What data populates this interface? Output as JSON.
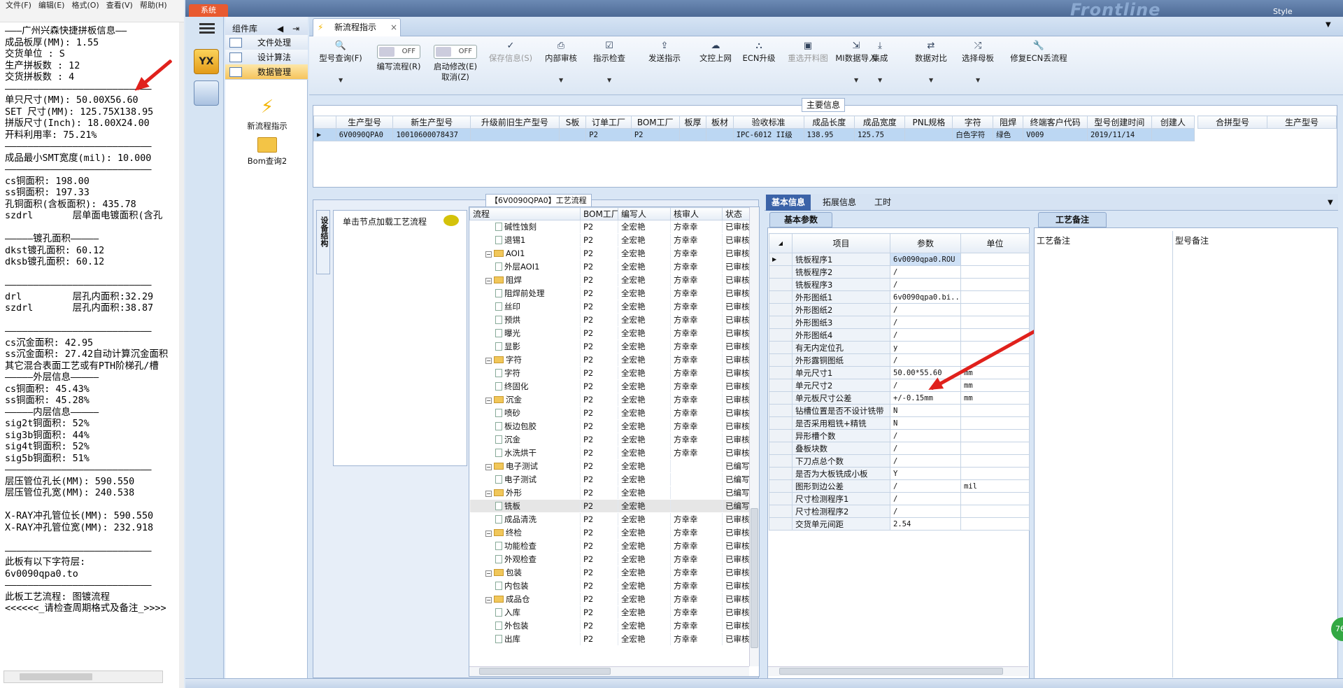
{
  "notepad": {
    "menu": [
      "文件(F)",
      "编辑(E)",
      "格式(O)",
      "查看(V)",
      "帮助(H)"
    ],
    "lines": [
      "———广州兴森快捷拼板信息——",
      "成品板厚(MM): 1.55",
      "交货单位 : S",
      "生产拼板数 : 12",
      "交货拼板数 : 4",
      "——————————————————————————",
      "单只尺寸(MM): 50.00X56.60",
      "SET 尺寸(MM): 125.75X138.95",
      "拼版尺寸(Inch): 18.00X24.00",
      "开料利用率: 75.21%",
      "——————————————————————————",
      "成品最小SMT宽度(mil): 10.000",
      "——————————————————————————",
      "cs铜面积: 198.00",
      "ss铜面积: 197.33",
      "孔铜面积(含板面积): 435.78",
      "szdrl       层单面电镀面积(含孔",
      "",
      "—————镀孔面积—————",
      "dkst镀孔面积: 60.12",
      "dksb镀孔面积: 60.12",
      "",
      "——————————————————————————",
      "drl         层孔内面积:32.29",
      "szdrl       层孔内面积:38.87",
      "",
      "——————————————————————————",
      "cs沉金面积: 42.95",
      "ss沉金面积: 27.42自动计算沉金面积",
      "其它混合表面工艺或有PTH阶梯孔/槽",
      "—————外层信息—————",
      "cs铜面积: 45.43%",
      "ss铜面积: 45.28%",
      "—————内层信息—————",
      "sig2t铜面积: 52%",
      "sig3b铜面积: 44%",
      "sig4t铜面积: 52%",
      "sig5b铜面积: 51%",
      "——————————————————————————",
      "层压管位孔长(MM): 590.550",
      "层压管位孔宽(MM): 240.538",
      "",
      "X-RAY冲孔管位长(MM): 590.550",
      "X-RAY冲孔管位宽(MM): 232.918",
      "",
      "——————————————————————————",
      "此板有以下字符层:",
      "6v0090qpa0.to",
      "——————————————————————————",
      "此板工艺流程: 图镀流程",
      "<<<<<<_请检查周期格式及备注_>>>>"
    ]
  },
  "app": {
    "sys_tab": "系统",
    "brand": "Frontline",
    "style_label": "Style",
    "component_lib": "组件库",
    "comp_items": [
      "文件处理",
      "设计算法",
      "数据管理"
    ],
    "tools": [
      "新流程指示",
      "Bom查询2"
    ],
    "doc_tab": "新流程指示",
    "ribbon": [
      {
        "label": "型号查询(F)",
        "icon": "search-icon",
        "dd": true,
        "dis": false
      },
      {
        "label": "编写流程(R)",
        "icon": "toggle-off",
        "dd": false,
        "dis": false,
        "toggle": "OFF"
      },
      {
        "label": "启动修改(E)\n取消(Z)",
        "icon": "toggle-off",
        "dd": false,
        "dis": false,
        "toggle": "OFF"
      },
      {
        "label": "保存信息(S)",
        "icon": "check-icon",
        "dd": false,
        "dis": true
      },
      {
        "label": "内部审核",
        "icon": "print-icon",
        "dd": true,
        "dis": false
      },
      {
        "label": "指示检查",
        "icon": "checklist-icon",
        "dd": true,
        "dis": false
      },
      {
        "label": "发送指示",
        "icon": "upload-icon",
        "dd": false,
        "dis": false
      },
      {
        "label": "文控上网",
        "icon": "cloud-icon",
        "dd": false,
        "dis": false
      },
      {
        "label": "ECN升级",
        "icon": "network-icon",
        "dd": false,
        "dis": false
      },
      {
        "label": "重选开料图",
        "icon": "image-icon",
        "dd": false,
        "dis": true
      },
      {
        "label": "MI数据导入",
        "icon": "import-icon",
        "dd": true,
        "dis": false
      },
      {
        "label": "集成",
        "icon": "download-icon",
        "dd": true,
        "dis": false
      },
      {
        "label": "数据对比",
        "icon": "compare-icon",
        "dd": true,
        "dis": false
      },
      {
        "label": "选择母板",
        "icon": "shuffle-icon",
        "dd": true,
        "dis": false
      },
      {
        "label": "修复ECN丢流程",
        "icon": "wrench-icon",
        "dd": false,
        "dis": false
      }
    ],
    "main_info_title": "主要信息",
    "main_cols": [
      "生产型号",
      "新生产型号",
      "升级前旧生产型号",
      "S板",
      "订单工厂",
      "BOM工厂",
      "板厚",
      "板材",
      "验收标准",
      "成品长度",
      "成品宽度",
      "PNL规格",
      "字符",
      "阻焊",
      "终端客户代码",
      "型号创建时间",
      "创建人"
    ],
    "main_row": [
      "6V0090QPA0",
      "10010600078437",
      "",
      "",
      "P2",
      "P2",
      "",
      "",
      "IPC-6012 II级",
      "138.95",
      "125.75",
      "",
      "白色字符",
      "绿色",
      "V009",
      "2019/11/14",
      ""
    ],
    "merge_cols": [
      "合拼型号",
      "生产型号"
    ],
    "flow_title": "【6V0090QPA0】工艺流程",
    "side_tab": "设备结构",
    "load_flow": "单击节点加载工艺流程",
    "flow_cols": [
      "流程",
      "BOM工厂",
      "编写人",
      "核审人",
      "状态"
    ],
    "flow_rows": [
      {
        "lvl": 2,
        "type": "doc",
        "name": "碱性蚀刻",
        "bom": "P2",
        "w": "全宏艳",
        "r": "方幸幸",
        "s": "已审核"
      },
      {
        "lvl": 2,
        "type": "doc",
        "name": "退锡1",
        "bom": "P2",
        "w": "全宏艳",
        "r": "方幸幸",
        "s": "已审核"
      },
      {
        "lvl": 1,
        "type": "folder",
        "name": "AOI1",
        "bom": "P2",
        "w": "全宏艳",
        "r": "方幸幸",
        "s": "已审核"
      },
      {
        "lvl": 2,
        "type": "doc",
        "name": "外层AOI1",
        "bom": "P2",
        "w": "全宏艳",
        "r": "方幸幸",
        "s": "已审核"
      },
      {
        "lvl": 1,
        "type": "folder",
        "name": "阻焊",
        "bom": "P2",
        "w": "全宏艳",
        "r": "方幸幸",
        "s": "已审核"
      },
      {
        "lvl": 2,
        "type": "doc",
        "name": "阻焊前处理",
        "bom": "P2",
        "w": "全宏艳",
        "r": "方幸幸",
        "s": "已审核"
      },
      {
        "lvl": 2,
        "type": "doc",
        "name": "丝印",
        "bom": "P2",
        "w": "全宏艳",
        "r": "方幸幸",
        "s": "已审核"
      },
      {
        "lvl": 2,
        "type": "doc",
        "name": "预烘",
        "bom": "P2",
        "w": "全宏艳",
        "r": "方幸幸",
        "s": "已审核"
      },
      {
        "lvl": 2,
        "type": "doc",
        "name": "曝光",
        "bom": "P2",
        "w": "全宏艳",
        "r": "方幸幸",
        "s": "已审核"
      },
      {
        "lvl": 2,
        "type": "doc",
        "name": "显影",
        "bom": "P2",
        "w": "全宏艳",
        "r": "方幸幸",
        "s": "已审核"
      },
      {
        "lvl": 1,
        "type": "folder",
        "name": "字符",
        "bom": "P2",
        "w": "全宏艳",
        "r": "方幸幸",
        "s": "已审核"
      },
      {
        "lvl": 2,
        "type": "doc",
        "name": "字符",
        "bom": "P2",
        "w": "全宏艳",
        "r": "方幸幸",
        "s": "已审核"
      },
      {
        "lvl": 2,
        "type": "doc",
        "name": "终固化",
        "bom": "P2",
        "w": "全宏艳",
        "r": "方幸幸",
        "s": "已审核"
      },
      {
        "lvl": 1,
        "type": "folder",
        "name": "沉金",
        "bom": "P2",
        "w": "全宏艳",
        "r": "方幸幸",
        "s": "已审核"
      },
      {
        "lvl": 2,
        "type": "doc",
        "name": "喷砂",
        "bom": "P2",
        "w": "全宏艳",
        "r": "方幸幸",
        "s": "已审核"
      },
      {
        "lvl": 2,
        "type": "doc",
        "name": "板边包胶",
        "bom": "P2",
        "w": "全宏艳",
        "r": "方幸幸",
        "s": "已审核"
      },
      {
        "lvl": 2,
        "type": "doc",
        "name": "沉金",
        "bom": "P2",
        "w": "全宏艳",
        "r": "方幸幸",
        "s": "已审核"
      },
      {
        "lvl": 2,
        "type": "doc",
        "name": "水洗烘干",
        "bom": "P2",
        "w": "全宏艳",
        "r": "方幸幸",
        "s": "已审核"
      },
      {
        "lvl": 1,
        "type": "folder",
        "name": "电子测试",
        "bom": "P2",
        "w": "全宏艳",
        "r": "",
        "s": "已编写"
      },
      {
        "lvl": 2,
        "type": "doc",
        "name": "电子测试",
        "bom": "P2",
        "w": "全宏艳",
        "r": "",
        "s": "已编写"
      },
      {
        "lvl": 1,
        "type": "folder",
        "name": "外形",
        "bom": "P2",
        "w": "全宏艳",
        "r": "",
        "s": "已编写"
      },
      {
        "lvl": 2,
        "type": "doc",
        "name": "铣板",
        "bom": "P2",
        "w": "全宏艳",
        "r": "",
        "s": "已编写",
        "sel": true
      },
      {
        "lvl": 2,
        "type": "doc",
        "name": "成品清洗",
        "bom": "P2",
        "w": "全宏艳",
        "r": "方幸幸",
        "s": "已审核"
      },
      {
        "lvl": 1,
        "type": "folder",
        "name": "终检",
        "bom": "P2",
        "w": "全宏艳",
        "r": "方幸幸",
        "s": "已审核"
      },
      {
        "lvl": 2,
        "type": "doc",
        "name": "功能检查",
        "bom": "P2",
        "w": "全宏艳",
        "r": "方幸幸",
        "s": "已审核"
      },
      {
        "lvl": 2,
        "type": "doc",
        "name": "外观检查",
        "bom": "P2",
        "w": "全宏艳",
        "r": "方幸幸",
        "s": "已审核"
      },
      {
        "lvl": 1,
        "type": "folder",
        "name": "包装",
        "bom": "P2",
        "w": "全宏艳",
        "r": "方幸幸",
        "s": "已审核"
      },
      {
        "lvl": 2,
        "type": "doc",
        "name": "内包装",
        "bom": "P2",
        "w": "全宏艳",
        "r": "方幸幸",
        "s": "已审核"
      },
      {
        "lvl": 1,
        "type": "folder",
        "name": "成品仓",
        "bom": "P2",
        "w": "全宏艳",
        "r": "方幸幸",
        "s": "已审核"
      },
      {
        "lvl": 2,
        "type": "doc",
        "name": "入库",
        "bom": "P2",
        "w": "全宏艳",
        "r": "方幸幸",
        "s": "已审核"
      },
      {
        "lvl": 2,
        "type": "doc",
        "name": "外包装",
        "bom": "P2",
        "w": "全宏艳",
        "r": "方幸幸",
        "s": "已审核"
      },
      {
        "lvl": 2,
        "type": "doc",
        "name": "出库",
        "bom": "P2",
        "w": "全宏艳",
        "r": "方幸幸",
        "s": "已审核"
      }
    ],
    "info_tabs": [
      "基本信息",
      "拓展信息",
      "工时"
    ],
    "basic_param_tab": "基本参数",
    "param_cols": [
      "项目",
      "参数",
      "单位"
    ],
    "params": [
      [
        "铣板程序1",
        "6v0090qpa0.ROU",
        ""
      ],
      [
        "铣板程序2",
        "/",
        ""
      ],
      [
        "铣板程序3",
        "/",
        ""
      ],
      [
        "外形图纸1",
        "6v0090qpa0.bi...",
        ""
      ],
      [
        "外形图纸2",
        "/",
        ""
      ],
      [
        "外形图纸3",
        "/",
        ""
      ],
      [
        "外形图纸4",
        "/",
        ""
      ],
      [
        "有无内定位孔",
        "y",
        ""
      ],
      [
        "外形露铜图纸",
        "/",
        ""
      ],
      [
        "单元尺寸1",
        "50.00*55.60",
        "mm"
      ],
      [
        "单元尺寸2",
        "/",
        "mm"
      ],
      [
        "单元板尺寸公差",
        "+/-0.15mm",
        "mm"
      ],
      [
        "钻槽位置是否不设计铣带",
        "N",
        ""
      ],
      [
        "是否采用粗铣+精铣",
        "N",
        ""
      ],
      [
        "异形槽个数",
        "/",
        ""
      ],
      [
        "叠板块数",
        "/",
        ""
      ],
      [
        "下刀点总个数",
        "/",
        ""
      ],
      [
        "是否为大板铣成小板",
        "Y",
        ""
      ],
      [
        "图形到边公差",
        "/",
        "mil"
      ],
      [
        "尺寸检测程序1",
        "/",
        ""
      ],
      [
        "尺寸检测程序2",
        "/",
        ""
      ],
      [
        "交货单元间距",
        "2.54",
        ""
      ]
    ],
    "remark_tab": "工艺备注",
    "remark_cols": [
      "工艺备注",
      "型号备注"
    ],
    "status_badge": "76"
  }
}
